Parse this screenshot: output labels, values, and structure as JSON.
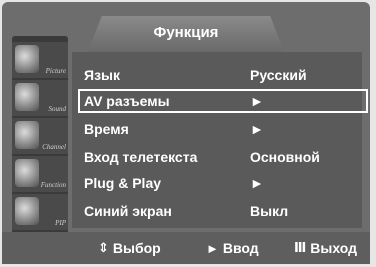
{
  "menu": {
    "title": "Функция",
    "sidebar": [
      {
        "label": "Picture"
      },
      {
        "label": "Sound"
      },
      {
        "label": "Channel"
      },
      {
        "label": "Function"
      },
      {
        "label": "PIP"
      }
    ],
    "items": [
      {
        "label": "Язык",
        "value": "Русский"
      },
      {
        "label": "AV разъемы",
        "value": "►"
      },
      {
        "label": "Время",
        "value": "►"
      },
      {
        "label": "Вход телетекста",
        "value": "Основной"
      },
      {
        "label": "Plug & Play",
        "value": "►"
      },
      {
        "label": "Синий экран",
        "value": "Выкл"
      }
    ],
    "selected_index": 1
  },
  "footer": {
    "select": {
      "icon": "up-down-arrows-icon",
      "glyph": "⇕",
      "label": "Выбор"
    },
    "enter": {
      "icon": "play-arrow-icon",
      "glyph": "►",
      "label": "Ввод"
    },
    "exit": {
      "icon": "menu-bars-icon",
      "glyph": "Ⅲ",
      "label": "Выход"
    }
  }
}
